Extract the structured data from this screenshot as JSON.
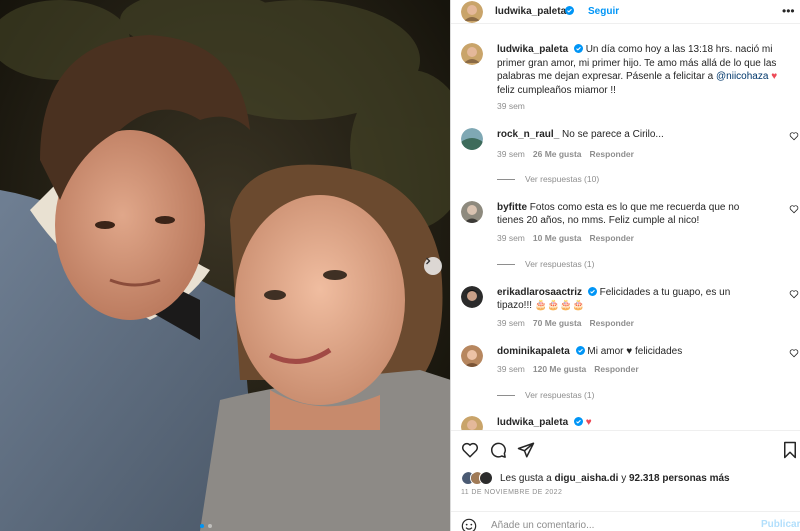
{
  "post": {
    "author": "ludwika_paleta",
    "follow_label": "Seguir",
    "more_label": "•••",
    "caption": {
      "author": "ludwika_paleta",
      "text_1": "Un día como hoy a las 13:18 hrs. nació mi primer gran amor, mi primer hijo. Te amo más allá de lo que las palabras me dejan expresar. Pásenle a felicitar a ",
      "mention": "@niicohaza",
      "heart": "♥",
      "text_2": "feliz cumpleaños miamor !!",
      "time": "39 sem"
    }
  },
  "comments": [
    {
      "user": "rock_n_raul_",
      "text": "No se parece a Cirilo...",
      "time": "39 sem",
      "likes": "26 Me gusta",
      "reply_label": "Responder",
      "replies": "Ver respuestas (10)"
    },
    {
      "user": "byfitte",
      "text": "Fotos como esta es lo que me recuerda que no tienes 20 años, no mms. Feliz cumple al nico!",
      "time": "39 sem",
      "likes": "10 Me gusta",
      "reply_label": "Responder",
      "replies": "Ver respuestas (1)"
    },
    {
      "user": "erikadlarosaactriz",
      "text": "Felicidades a tu guapo, es un tipazo!!! 🎂🎂🎂🎂",
      "time": "39 sem",
      "likes": "70 Me gusta",
      "reply_label": "Responder"
    },
    {
      "user": "dominikapaleta",
      "text": "Mi amor ♥ felicidades",
      "time": "39 sem",
      "likes": "120 Me gusta",
      "reply_label": "Responder",
      "replies": "Ver respuestas (1)"
    },
    {
      "user": "ludwika_paleta",
      "text": "♥"
    }
  ],
  "engagement": {
    "likes_prefix": "Les gusta a",
    "likes_user": "digu_aisha.di",
    "likes_mid": "y",
    "likes_count": "92.318 personas más",
    "date": "11 DE NOVIEMBRE DE 2022"
  },
  "composer": {
    "placeholder": "Añade un comentario...",
    "publish_label": "Publicar"
  },
  "colors": {
    "accent": "#0095f6",
    "heart": "#ed4956",
    "muted": "#8e8e8e"
  },
  "icons": [
    "verified-icon",
    "heart-icon",
    "comment-icon",
    "share-icon",
    "bookmark-icon",
    "emoji-icon",
    "chevron-right-icon",
    "more-icon"
  ]
}
